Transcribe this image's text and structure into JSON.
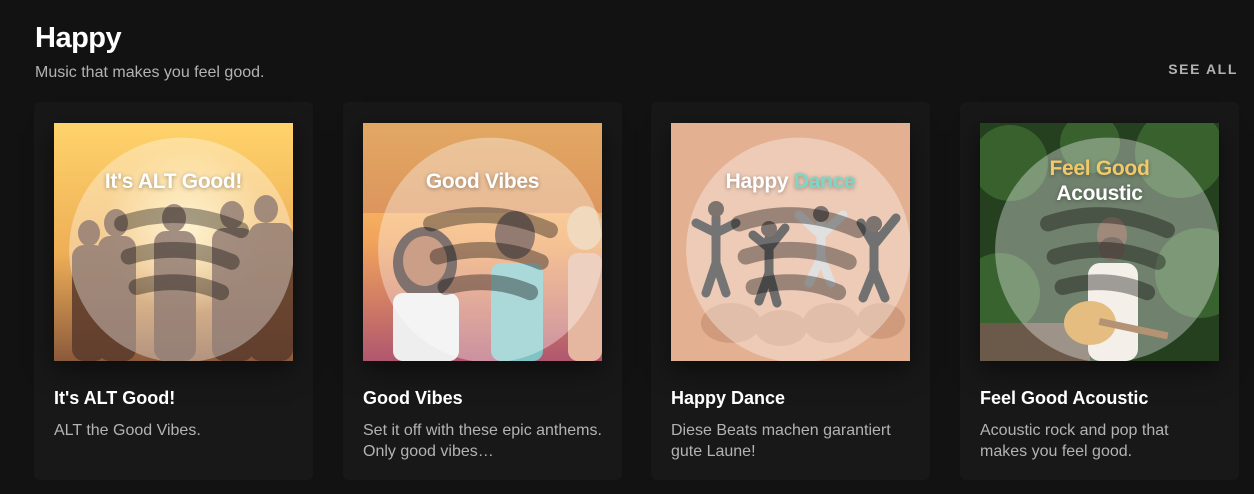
{
  "section": {
    "title": "Happy",
    "subtitle": "Music that makes you feel good.",
    "see_all": "SEE ALL"
  },
  "playlists": [
    {
      "title": "It's ALT Good!",
      "description": "ALT the Good Vibes.",
      "cover_text": "It's ALT Good!",
      "cover_colors": [
        "#ffd36b",
        "#e39a45",
        "#8b5a3c"
      ]
    },
    {
      "title": "Good Vibes",
      "description": "Set it off with these epic anthems. Only good vibes…",
      "cover_text": "Good Vibes",
      "cover_colors": [
        "#ffd56a",
        "#f1a35b",
        "#b0576f"
      ]
    },
    {
      "title": "Happy Dance",
      "description": "Diese Beats machen garantiert gute Laune!",
      "cover_text_1": "Happy",
      "cover_text_2": "Dance",
      "cover_colors": [
        "#e8b493",
        "#d9a07f",
        "#7ed7c6"
      ]
    },
    {
      "title": "Feel Good Acoustic",
      "description": "Acoustic rock and pop that makes you feel good.",
      "cover_text_1": "Feel Good",
      "cover_text_2": "Acoustic",
      "cover_colors": [
        "#2f5a2b",
        "#1e3a1c",
        "#f2c86a"
      ]
    }
  ]
}
